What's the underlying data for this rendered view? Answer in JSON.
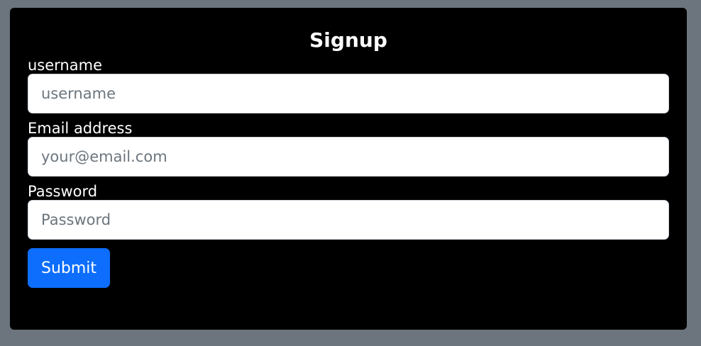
{
  "form": {
    "title": "Signup",
    "fields": [
      {
        "label": "username",
        "placeholder": "username",
        "value": ""
      },
      {
        "label": "Email address",
        "placeholder": "your@email.com",
        "value": ""
      },
      {
        "label": "Password",
        "placeholder": "Password",
        "value": ""
      }
    ],
    "submit_label": "Submit"
  },
  "colors": {
    "page_background": "#6c757d",
    "card_background": "#000000",
    "button_primary": "#0d6efd",
    "text_light": "#ffffff"
  }
}
